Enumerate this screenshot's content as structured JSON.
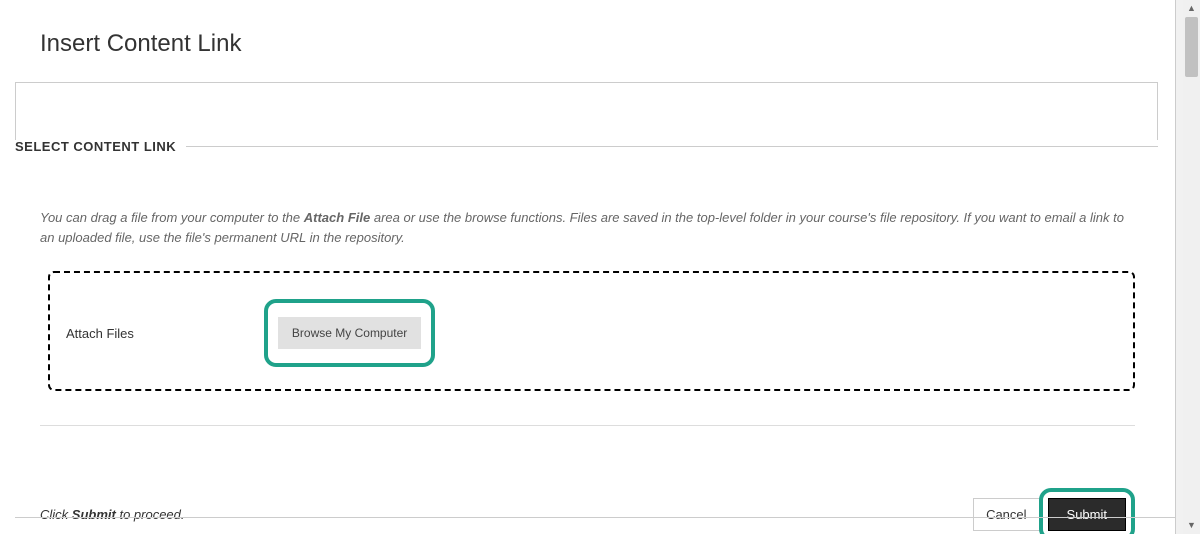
{
  "page": {
    "title": "Insert Content Link"
  },
  "section": {
    "heading": "SELECT CONTENT LINK",
    "description_pre": "You can drag a file from your computer to the ",
    "description_strong": "Attach File",
    "description_post": " area or use the browse functions. Files are saved in the top-level folder in your course's file repository. If you want to email a link to an uploaded file, use the file's permanent URL in the repository."
  },
  "attach": {
    "label": "Attach Files",
    "browse_label": "Browse My Computer"
  },
  "footer": {
    "hint_pre": "Click ",
    "hint_strong": "Submit",
    "hint_post": " to proceed.",
    "cancel_label": "Cancel",
    "submit_label": "Submit"
  },
  "scroll": {
    "up": "▲",
    "down": "▼"
  }
}
